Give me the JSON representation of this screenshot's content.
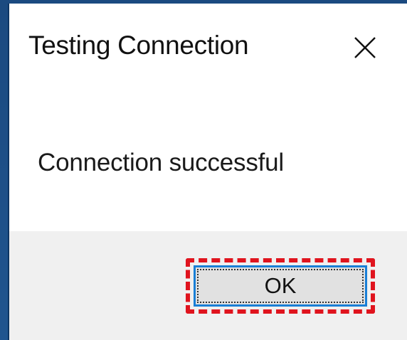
{
  "dialog": {
    "title": "Testing Connection",
    "close_icon": "close-icon",
    "message": "Connection successful",
    "ok_label": "OK"
  },
  "colors": {
    "backdrop": "#1e4f86",
    "highlight": "#e0141e",
    "button_border": "#1a7fd6",
    "footer": "#f0f0f0"
  }
}
